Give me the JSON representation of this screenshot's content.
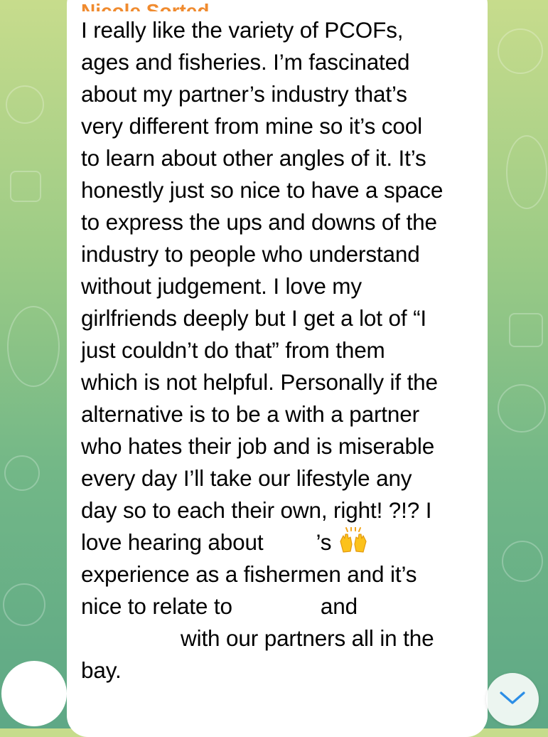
{
  "message": {
    "sender": "Nicole Sorted",
    "lines": [
      "I really like the variety of PCOFs,",
      "ages and fisheries. I’m fascinated",
      "about my partner’s industry that’s",
      "very different from mine so it’s cool",
      "to learn about other angles of it. It’s",
      "honestly just so nice to have a space",
      "to express the ups and downs of the",
      "industry to people who understand",
      "without judgement. I love my",
      "girlfriends deeply but I get a lot of “I",
      "just couldn’t do that” from them",
      "which is not helpful. Personally if the",
      "alternative is to be a with a partner",
      "who hates their job and is miserable",
      "every day I’ll take our lifestyle any",
      "day so to each their own, right! ?!? I"
    ],
    "line17_a": "love hearing about",
    "line17_b": "’s",
    "line18": "experience as a fishermen and it’s",
    "line19_a": "nice to relate to",
    "line19_b": "and",
    "line20": "with our partners all in the",
    "line21": "bay.",
    "emoji_name": "raising-hands-emoji"
  },
  "icons": {
    "scroll_down": "chevron-down-icon"
  },
  "colors": {
    "sender_name": "#f08b2f",
    "bubble": "#ffffff",
    "scroll_chevron": "#2c8ee6"
  }
}
